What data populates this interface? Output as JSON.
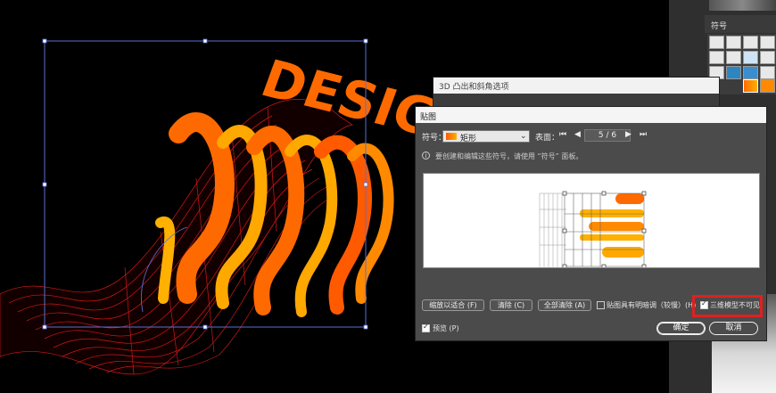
{
  "canvas": {
    "artwork_text": "DESIGN",
    "accent_orange": "#ff6a00",
    "accent_yellow": "#ffa800",
    "wire_red": "#d01818",
    "selection_blue": "#5a6fd6"
  },
  "right_panel": {
    "symbols_panel_title": "符号"
  },
  "extrude_dialog": {
    "title": "3D 凸出和斜角选项"
  },
  "map_art_dialog": {
    "title": "贴图",
    "symbol_label": "符号：",
    "symbol_value": "矩形",
    "surface_label": "表面：",
    "page_indicator": "5 / 6",
    "first_icon": "first-page-icon",
    "prev_icon": "prev-page-icon",
    "next_icon": "next-page-icon",
    "last_icon": "last-page-icon",
    "info_text": "要创建和编辑这些符号，请使用 “符号” 面板。",
    "buttons": {
      "scale_to_fit": "缩放以适合 (F)",
      "clear": "清除 (C)",
      "clear_all": "全部清除 (A)"
    },
    "shade_artwork_label": "贴图具有明暗调（较慢）(H)",
    "shade_artwork_checked": false,
    "invisible_geometry_label": "三维模型不可见",
    "invisible_geometry_checked": true,
    "preview_label": "预览 (P)",
    "preview_checked": true,
    "ok_label": "确定",
    "cancel_label": "取消",
    "highlight_color": "#e02020"
  }
}
